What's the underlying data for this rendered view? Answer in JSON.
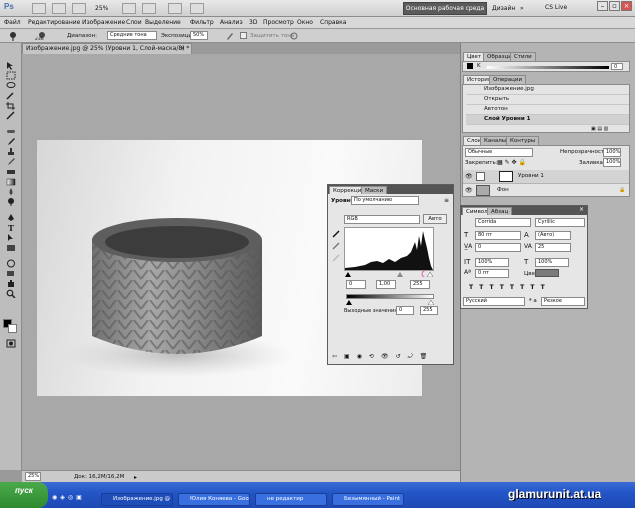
{
  "appbar": {
    "logo": "Ps",
    "zoom": "25%",
    "workspace": "Основная рабочая среда",
    "design": "Дизайн",
    "cslive": "CS Live"
  },
  "menu": [
    "Файл",
    "Редактирование",
    "Изображение",
    "Слои",
    "Выделение",
    "Фильтр",
    "Анализ",
    "3D",
    "Просмотр",
    "Окно",
    "Справка"
  ],
  "options": {
    "range_label": "Диапазон:",
    "range_value": "Средние тона",
    "exposure_label": "Экспозиция:",
    "exposure_value": "50%",
    "brush_size": "236",
    "protect_label": "Защитить тона"
  },
  "document": {
    "tab": "Изображение.jpg @ 25% (Уровни 1, Слой-маска/8) *",
    "zoom": "25%",
    "doc_size": "Док: 16,2M/16,2M"
  },
  "color_panel": {
    "tabs": [
      "Цвет",
      "Образцы",
      "Стили"
    ],
    "channel": "K",
    "value": "0"
  },
  "history_panel": {
    "tabs": [
      "История",
      "Операции"
    ],
    "items": [
      "Изображение.jpg",
      "Открыть",
      "Автотон",
      "Слой Уровни 1"
    ]
  },
  "layers_panel": {
    "tabs": [
      "Слои",
      "Каналы",
      "Контуры"
    ],
    "blend": "Обычные",
    "opacity_label": "Непрозрачность:",
    "opacity": "100%",
    "lock_label": "Закрепить:",
    "fill_label": "Заливка:",
    "fill": "100%",
    "layers": [
      "Уровни 1",
      "Фон"
    ]
  },
  "adjustments": {
    "tabs": [
      "Коррекция",
      "Маски"
    ],
    "title": "Уровни",
    "preset": "По умолчанию",
    "channel": "RGB",
    "auto": "Авто",
    "input": [
      "0",
      "1,00",
      "255"
    ],
    "output_label": "Выходные значения:",
    "output": [
      "0",
      "255"
    ]
  },
  "character": {
    "tabs": [
      "Символ",
      "Абзац"
    ],
    "font": "Corrida",
    "style": "Cyrillic",
    "size": "80 пт",
    "leading": "(Авто)",
    "kerning": "0",
    "tracking": "25",
    "vscale": "100%",
    "hscale": "100%",
    "baseline": "0 пт",
    "color_label": "Цвет:",
    "language": "Русский",
    "antialias": "Резкое",
    "color": "#7b7b7b"
  },
  "taskbar": {
    "start": "пуск",
    "tasks": [
      "Изображение.jpg @ 25...",
      "Юлия Коняева - Goo...",
      "не редактир",
      "Безымянный - Paint"
    ]
  },
  "watermark": "glamurunit.at.ua"
}
